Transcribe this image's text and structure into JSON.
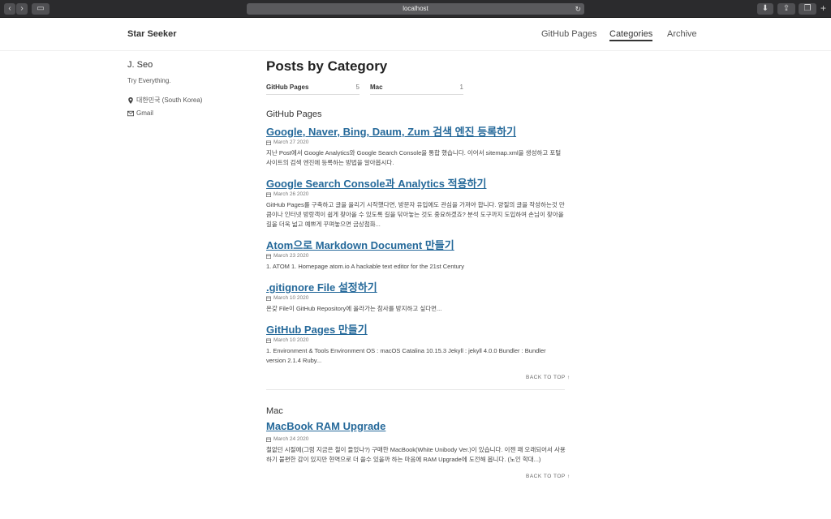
{
  "browser": {
    "url": "localhost"
  },
  "site": {
    "title": "Star Seeker"
  },
  "nav": [
    "GitHub Pages",
    "Categories",
    "Archive"
  ],
  "author": {
    "name": "J. Seo",
    "bio": "Try Everything.",
    "location": "대한민국 (South Korea)",
    "email_label": "Gmail"
  },
  "page": {
    "title": "Posts by Category"
  },
  "taxonomy": [
    {
      "name": "GitHub Pages",
      "count": "5"
    },
    {
      "name": "Mac",
      "count": "1"
    }
  ],
  "categories": [
    {
      "name": "GitHub Pages",
      "posts": [
        {
          "title": "Google, Naver, Bing, Daum, Zum 검색 엔진 등록하기",
          "date": "March 27 2020",
          "excerpt": "지난 Post에서 Google Analytics와 Google Search Console을 통합 했습니다. 이어서 sitemap.xml을 생성하고 포털 사이트의 검색 엔진에 등록하는 방법을 알아봅시다."
        },
        {
          "title": "Google Search Console과 Analytics 적용하기",
          "date": "March 26 2020",
          "excerpt": "GitHub Pages를 구축하고 글을 올리기 시작했다면, 방문자 유입에도 관심을 가져야 합니다. 양질의 글을 작성하는것 만큼이나 인터넷 방랑객이 쉽게 찾아올 수 있도록 길을 닦아놓는 것도 중요하겠죠? 분석 도구까지 도입하여 손님이 찾아올 길을 더욱 넓고 예쁘게 꾸며놓으면 금상첨화..."
        },
        {
          "title": "Atom으로 Markdown Document 만들기",
          "date": "March 23 2020",
          "excerpt": "1. ATOM 1. Homepage atom.io A hackable text editor for the 21st Century"
        },
        {
          "title": ".gitignore File 설정하기",
          "date": "March 10 2020",
          "excerpt": "온갖 File이 GitHub Repository에 올라가는 참사를 방지하고 싶다면..."
        },
        {
          "title": "GitHub Pages 만들기",
          "date": "March 10 2020",
          "excerpt": "1. Environment & Tools Environment OS : macOS Catalina 10.15.3 Jekyll : jekyll 4.0.0 Bundler : Bundler version 2.1.4 Ruby..."
        }
      ]
    },
    {
      "name": "Mac",
      "posts": [
        {
          "title": "MacBook RAM Upgrade",
          "date": "March 24 2020",
          "excerpt": "철없던 시절에(그럼 지금은 철이 들었나?) 구매한 MacBook(White Unibody Ver.)이 있습니다. 이젠 꽤 오래되어서 사용하기 불편한 감이 있지만 현역으로 더 쓸수 있을까 하는 마음에 RAM Upgrade에 도전해 봅니다. (노인 학대...)"
        }
      ]
    }
  ],
  "back_to_top": "BACK TO TOP ↑"
}
